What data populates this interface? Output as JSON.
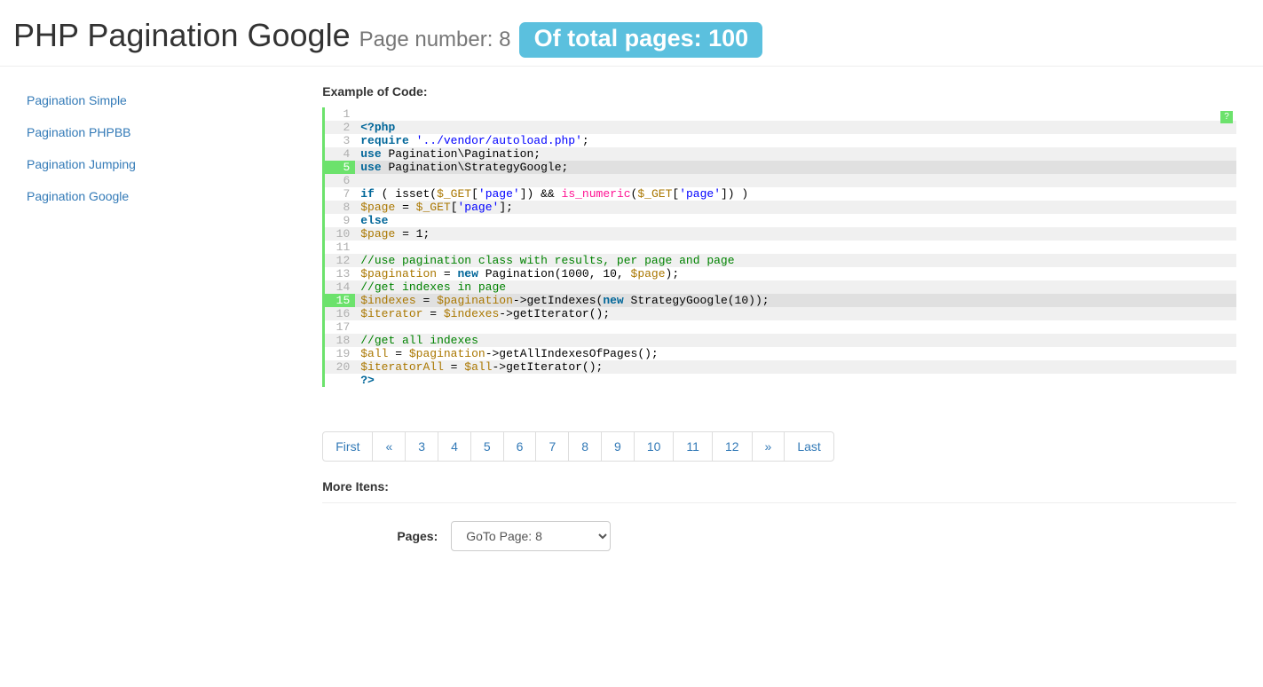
{
  "header": {
    "title": "PHP Pagination Google",
    "subtitle_prefix": "Page number: ",
    "page_number": "8",
    "badge": "Of total pages: 100"
  },
  "sidebar": {
    "items": [
      {
        "label": "Pagination Simple"
      },
      {
        "label": "Pagination PHPBB"
      },
      {
        "label": "Pagination Jumping"
      },
      {
        "label": "Pagination Google"
      }
    ]
  },
  "example": {
    "title": "Example of Code:",
    "help": "?",
    "lines": [
      {
        "n": "1",
        "alt": false,
        "hl": false,
        "tokens": [
          {
            "c": "plain",
            "t": " "
          }
        ]
      },
      {
        "n": "2",
        "alt": true,
        "hl": false,
        "tokens": [
          {
            "c": "kw",
            "t": "<?php"
          }
        ]
      },
      {
        "n": "3",
        "alt": false,
        "hl": false,
        "tokens": [
          {
            "c": "kw",
            "t": "require"
          },
          {
            "c": "plain",
            "t": " "
          },
          {
            "c": "str",
            "t": "'../vendor/autoload.php'"
          },
          {
            "c": "plain",
            "t": ";"
          }
        ]
      },
      {
        "n": "4",
        "alt": true,
        "hl": false,
        "tokens": [
          {
            "c": "kw",
            "t": "use"
          },
          {
            "c": "plain",
            "t": " Pagination\\Pagination;"
          }
        ]
      },
      {
        "n": "5",
        "alt": false,
        "hl": true,
        "tokens": [
          {
            "c": "kw",
            "t": "use"
          },
          {
            "c": "plain",
            "t": " Pagination\\StrategyGoogle;"
          }
        ]
      },
      {
        "n": "6",
        "alt": true,
        "hl": false,
        "tokens": [
          {
            "c": "plain",
            "t": " "
          }
        ]
      },
      {
        "n": "7",
        "alt": false,
        "hl": false,
        "tokens": [
          {
            "c": "kw",
            "t": "if"
          },
          {
            "c": "plain",
            "t": " ( isset("
          },
          {
            "c": "var",
            "t": "$_GET"
          },
          {
            "c": "plain",
            "t": "["
          },
          {
            "c": "str",
            "t": "'page'"
          },
          {
            "c": "plain",
            "t": "]) && "
          },
          {
            "c": "fn",
            "t": "is_numeric"
          },
          {
            "c": "plain",
            "t": "("
          },
          {
            "c": "var",
            "t": "$_GET"
          },
          {
            "c": "plain",
            "t": "["
          },
          {
            "c": "str",
            "t": "'page'"
          },
          {
            "c": "plain",
            "t": "]) )"
          }
        ]
      },
      {
        "n": "8",
        "alt": true,
        "hl": false,
        "tokens": [
          {
            "c": "var",
            "t": "$page"
          },
          {
            "c": "plain",
            "t": " = "
          },
          {
            "c": "var",
            "t": "$_GET"
          },
          {
            "c": "plain",
            "t": "["
          },
          {
            "c": "str",
            "t": "'page'"
          },
          {
            "c": "plain",
            "t": "];"
          }
        ]
      },
      {
        "n": "9",
        "alt": false,
        "hl": false,
        "tokens": [
          {
            "c": "kw",
            "t": "else"
          }
        ]
      },
      {
        "n": "10",
        "alt": true,
        "hl": false,
        "tokens": [
          {
            "c": "var",
            "t": "$page"
          },
          {
            "c": "plain",
            "t": " = 1;"
          }
        ]
      },
      {
        "n": "11",
        "alt": false,
        "hl": false,
        "tokens": [
          {
            "c": "plain",
            "t": " "
          }
        ]
      },
      {
        "n": "12",
        "alt": true,
        "hl": false,
        "tokens": [
          {
            "c": "cmt",
            "t": "//use pagination class with results, per page and page"
          }
        ]
      },
      {
        "n": "13",
        "alt": false,
        "hl": false,
        "tokens": [
          {
            "c": "var",
            "t": "$pagination"
          },
          {
            "c": "plain",
            "t": " = "
          },
          {
            "c": "kw",
            "t": "new"
          },
          {
            "c": "plain",
            "t": " Pagination(1000, 10, "
          },
          {
            "c": "var",
            "t": "$page"
          },
          {
            "c": "plain",
            "t": ");"
          }
        ]
      },
      {
        "n": "14",
        "alt": true,
        "hl": false,
        "tokens": [
          {
            "c": "cmt",
            "t": "//get indexes in page"
          }
        ]
      },
      {
        "n": "15",
        "alt": false,
        "hl": true,
        "tokens": [
          {
            "c": "var",
            "t": "$indexes"
          },
          {
            "c": "plain",
            "t": " = "
          },
          {
            "c": "var",
            "t": "$pagination"
          },
          {
            "c": "plain",
            "t": "->getIndexes("
          },
          {
            "c": "kw",
            "t": "new"
          },
          {
            "c": "plain",
            "t": " StrategyGoogle(10));"
          }
        ]
      },
      {
        "n": "16",
        "alt": true,
        "hl": false,
        "tokens": [
          {
            "c": "var",
            "t": "$iterator"
          },
          {
            "c": "plain",
            "t": " = "
          },
          {
            "c": "var",
            "t": "$indexes"
          },
          {
            "c": "plain",
            "t": "->getIterator();"
          }
        ]
      },
      {
        "n": "17",
        "alt": false,
        "hl": false,
        "tokens": [
          {
            "c": "plain",
            "t": " "
          }
        ]
      },
      {
        "n": "18",
        "alt": true,
        "hl": false,
        "tokens": [
          {
            "c": "cmt",
            "t": "//get all indexes"
          }
        ]
      },
      {
        "n": "19",
        "alt": false,
        "hl": false,
        "tokens": [
          {
            "c": "var",
            "t": "$all"
          },
          {
            "c": "plain",
            "t": " = "
          },
          {
            "c": "var",
            "t": "$pagination"
          },
          {
            "c": "plain",
            "t": "->getAllIndexesOfPages();"
          }
        ]
      },
      {
        "n": "20",
        "alt": true,
        "hl": false,
        "tokens": [
          {
            "c": "var",
            "t": "$iteratorAll"
          },
          {
            "c": "plain",
            "t": " = "
          },
          {
            "c": "var",
            "t": "$all"
          },
          {
            "c": "plain",
            "t": "->getIterator();"
          }
        ]
      },
      {
        "n": "",
        "alt": false,
        "hl": false,
        "tokens": [
          {
            "c": "kw",
            "t": "?>"
          }
        ]
      }
    ]
  },
  "pagination": {
    "items": [
      {
        "label": "First"
      },
      {
        "label": "«"
      },
      {
        "label": "3"
      },
      {
        "label": "4"
      },
      {
        "label": "5"
      },
      {
        "label": "6"
      },
      {
        "label": "7"
      },
      {
        "label": "8"
      },
      {
        "label": "9"
      },
      {
        "label": "10"
      },
      {
        "label": "11"
      },
      {
        "label": "12"
      },
      {
        "label": "»"
      },
      {
        "label": "Last"
      }
    ]
  },
  "more_items": {
    "title": "More Itens:",
    "form_label": "Pages:",
    "selected": "GoTo Page: 8"
  }
}
